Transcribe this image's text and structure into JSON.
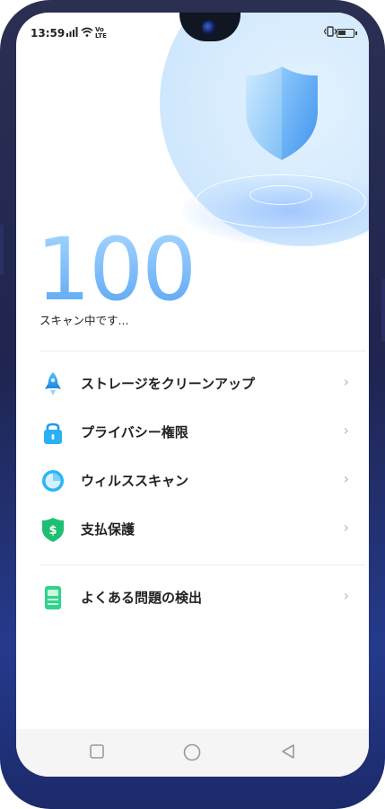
{
  "status_bar": {
    "time": "13:59",
    "network_badge_top": "Vo",
    "network_badge_bottom": "LTE",
    "icons": [
      "signal-icon",
      "wifi-icon",
      "volte-icon",
      "vibrate-icon",
      "battery-icon"
    ]
  },
  "hero": {
    "score": "100",
    "status": "スキャン中です..."
  },
  "menu": {
    "items": [
      {
        "label": "ストレージをクリーンアップ",
        "icon": "rocket-icon"
      },
      {
        "label": "プライバシー権限",
        "icon": "lock-icon"
      },
      {
        "label": "ウィルススキャン",
        "icon": "virus-scan-icon"
      },
      {
        "label": "支払保護",
        "icon": "payment-shield-icon"
      }
    ],
    "extra": {
      "label": "よくある問題の検出",
      "icon": "diagnostic-icon"
    },
    "chevron": "›"
  },
  "nav": {
    "icons": [
      "recent-apps-icon",
      "home-icon",
      "back-icon"
    ]
  },
  "colors": {
    "accent": "#5aa6f4",
    "nav_bg": "#f5f5f5",
    "phone_frame": "#1f2550"
  }
}
